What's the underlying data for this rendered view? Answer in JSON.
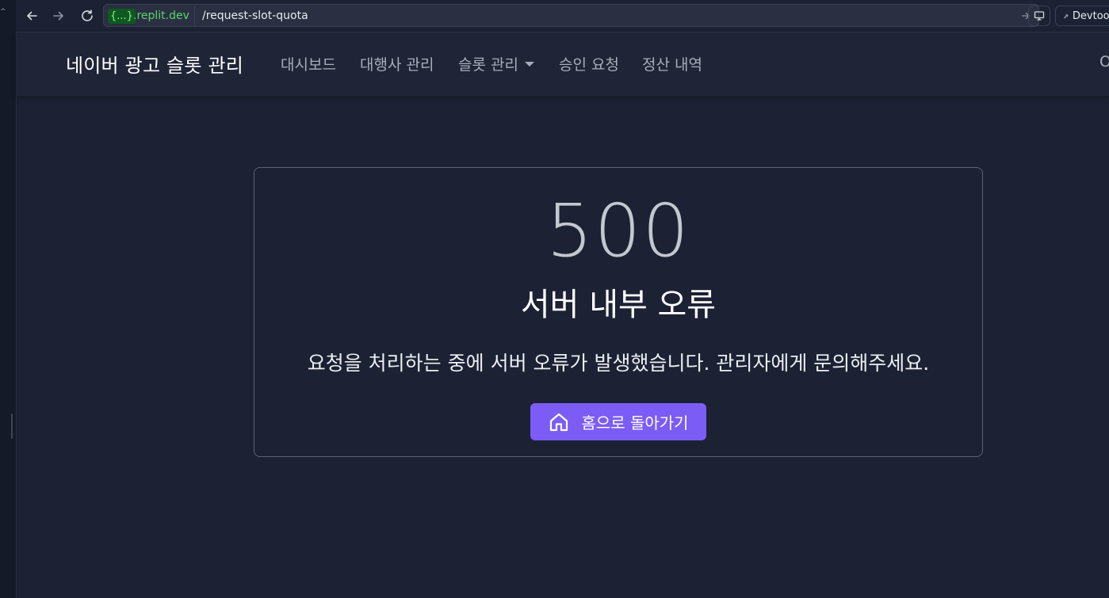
{
  "browser": {
    "domain_chip": "{...}",
    "domain_rest": ".replit.dev",
    "path": "/request-slot-quota",
    "devtools_label": "Devtools"
  },
  "navbar": {
    "brand": "네이버 광고 슬롯 관리",
    "items": [
      {
        "label": "대시보드",
        "icon": null
      },
      {
        "label": "대행사 관리",
        "icon": null
      },
      {
        "label": "슬롯 관리",
        "icon": "chevron-down-icon"
      },
      {
        "label": "승인 요청",
        "icon": null
      },
      {
        "label": "정산 내역",
        "icon": null
      }
    ],
    "right_clip": "O"
  },
  "error": {
    "code": "500",
    "title": "서버 내부 오류",
    "message": "요청을 처리하는 중에 서버 오류가 발생했습니다. 관리자에게 문의해주세요.",
    "home_button": "홈으로 돌아가기",
    "home_icon": "home-icon"
  },
  "colors": {
    "background": "#1c2234",
    "navbar": "#1f2537",
    "accent": "#7b5cf5",
    "domain_green": "#5bd36b"
  }
}
